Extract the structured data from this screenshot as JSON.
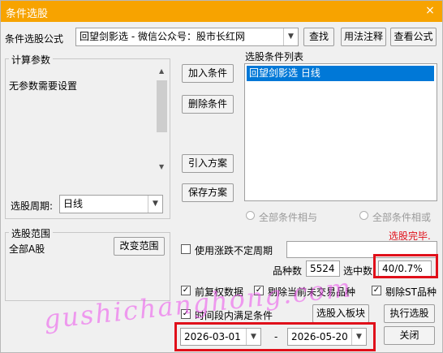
{
  "window": {
    "title": "条件选股",
    "close_icon": "×"
  },
  "formula": {
    "label": "条件选股公式",
    "value": "回望剑影选  -  微信公众号：股市长红网",
    "find_button": "查找",
    "usage_button": "用法注释",
    "view_button": "查看公式"
  },
  "params": {
    "group_title": "计算参数",
    "no_params_text": "无参数需要设置",
    "period_label": "选股周期:",
    "period_value": "日线"
  },
  "conditions": {
    "add_button": "加入条件",
    "delete_button": "删除条件",
    "import_button": "引入方案",
    "save_button": "保存方案",
    "list_label": "选股条件列表",
    "items": [
      "回望剑影选  日线"
    ]
  },
  "logic": {
    "all_and": "全部条件相与",
    "all_or": "全部条件相或"
  },
  "status": {
    "text": "选股完毕.",
    "color": "#e0101a"
  },
  "range": {
    "group_title": "选股范围",
    "value": "全部A股",
    "change_button": "改变范围"
  },
  "uncertain_period": {
    "label": "使用涨跌不定周期",
    "checked": false
  },
  "stats": {
    "count_label": "品种数",
    "count_value": "5524",
    "selected_label": "选中数",
    "selected_value": "40/0.7%"
  },
  "options": {
    "adjusted": {
      "label": "前复权数据",
      "checked": true
    },
    "exclude_untraded": {
      "label": "剔除当前未交易品种",
      "checked": true
    },
    "exclude_st": {
      "label": "剔除ST品种",
      "checked": true
    },
    "time_range": {
      "label": "时间段内满足条件",
      "checked": true
    }
  },
  "dates": {
    "start": "2026-03-01",
    "separator": "-",
    "end": "2026-05-20"
  },
  "actions": {
    "to_block": "选股入板块",
    "execute": "执行选股",
    "close": "关闭"
  },
  "watermark": "gushichanghong.com",
  "colors": {
    "title_bar": "#f7a300",
    "selection": "#0078d7",
    "highlight_box": "#e0101a",
    "watermark": "#ec50ec"
  }
}
